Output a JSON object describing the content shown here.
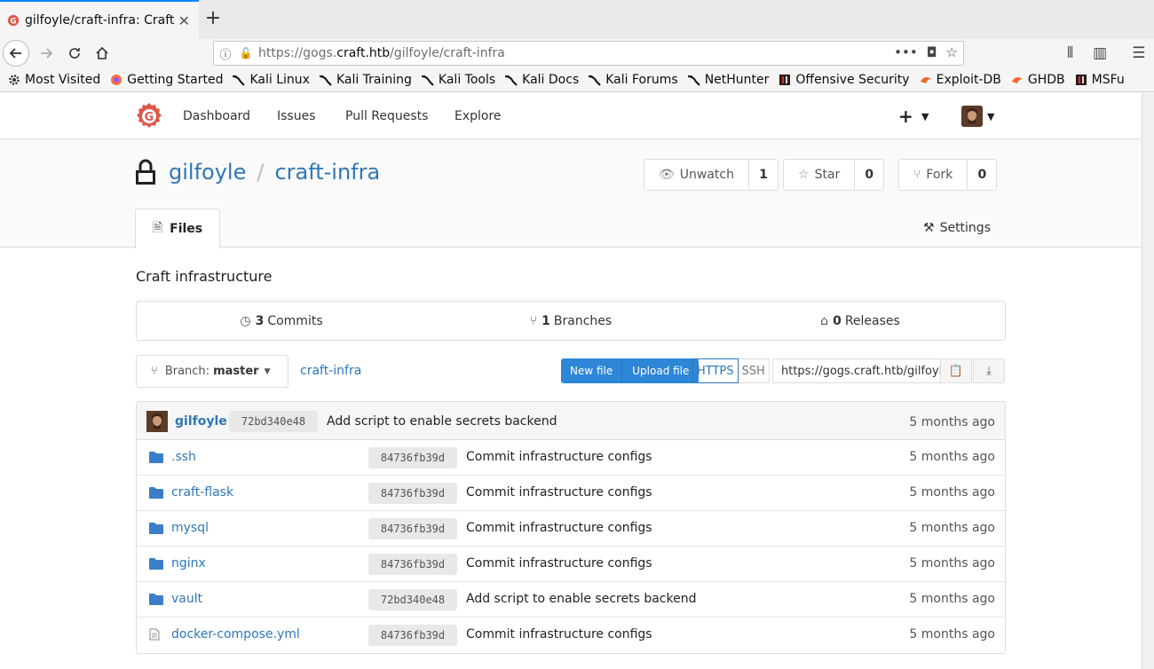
{
  "browser": {
    "tab_title": "gilfoyle/craft-infra: Craft",
    "new_tab": "+",
    "url_prefix": "https://gogs.",
    "url_host": "craft.htb",
    "url_path": "/gilfoyle/craft-infra",
    "bookmarks": [
      {
        "label": "Most Visited",
        "icon": "gear-icon"
      },
      {
        "label": "Getting Started",
        "icon": "firefox-icon"
      },
      {
        "label": "Kali Linux",
        "icon": "kali-icon"
      },
      {
        "label": "Kali Training",
        "icon": "kali-icon"
      },
      {
        "label": "Kali Tools",
        "icon": "kali-icon"
      },
      {
        "label": "Kali Docs",
        "icon": "kali-icon"
      },
      {
        "label": "Kali Forums",
        "icon": "kali-icon"
      },
      {
        "label": "NetHunter",
        "icon": "kali-icon"
      },
      {
        "label": "Offensive Security",
        "icon": "offsec-icon"
      },
      {
        "label": "Exploit-DB",
        "icon": "exploitdb-icon"
      },
      {
        "label": "GHDB",
        "icon": "exploitdb-icon"
      },
      {
        "label": "MSFu",
        "icon": "offsec-icon"
      }
    ]
  },
  "nav": {
    "items": [
      "Dashboard",
      "Issues",
      "Pull Requests",
      "Explore"
    ]
  },
  "repo": {
    "owner": "gilfoyle",
    "separator": "/",
    "name": "craft-infra",
    "unwatch_label": "Unwatch",
    "watch_count": "1",
    "star_label": "Star",
    "star_count": "0",
    "fork_label": "Fork",
    "fork_count": "0",
    "files_tab": "Files",
    "settings_tab": "Settings",
    "description": "Craft infrastructure",
    "commits_count": "3",
    "commits_label": "Commits",
    "branches_count": "1",
    "branches_label": "Branches",
    "releases_count": "0",
    "releases_label": "Releases",
    "branch_prefix": "Branch:",
    "branch_name": "master",
    "path": "craft-infra",
    "new_file": "New file",
    "upload_file": "Upload file",
    "https_label": "HTTPS",
    "ssh_label": "SSH",
    "clone_url": "https://gogs.craft.htb/gilfoyle/craft-infra.git"
  },
  "last_commit": {
    "user": "gilfoyle",
    "sha": "72bd340e48",
    "message": "Add script to enable secrets backend",
    "age": "5 months ago"
  },
  "files": [
    {
      "name": ".ssh",
      "type": "folder",
      "sha": "84736fb39d",
      "message": "Commit infrastructure configs",
      "age": "5 months ago"
    },
    {
      "name": "craft-flask",
      "type": "folder",
      "sha": "84736fb39d",
      "message": "Commit infrastructure configs",
      "age": "5 months ago"
    },
    {
      "name": "mysql",
      "type": "folder",
      "sha": "84736fb39d",
      "message": "Commit infrastructure configs",
      "age": "5 months ago"
    },
    {
      "name": "nginx",
      "type": "folder",
      "sha": "84736fb39d",
      "message": "Commit infrastructure configs",
      "age": "5 months ago"
    },
    {
      "name": "vault",
      "type": "folder",
      "sha": "72bd340e48",
      "message": "Add script to enable secrets backend",
      "age": "5 months ago"
    },
    {
      "name": "docker-compose.yml",
      "type": "file",
      "sha": "84736fb39d",
      "message": "Commit infrastructure configs",
      "age": "5 months ago"
    }
  ],
  "colors": {
    "link": "#2e77b7",
    "primary_button": "#2e86d6",
    "logo": "#e0574a",
    "folder": "#3b7ec8"
  }
}
